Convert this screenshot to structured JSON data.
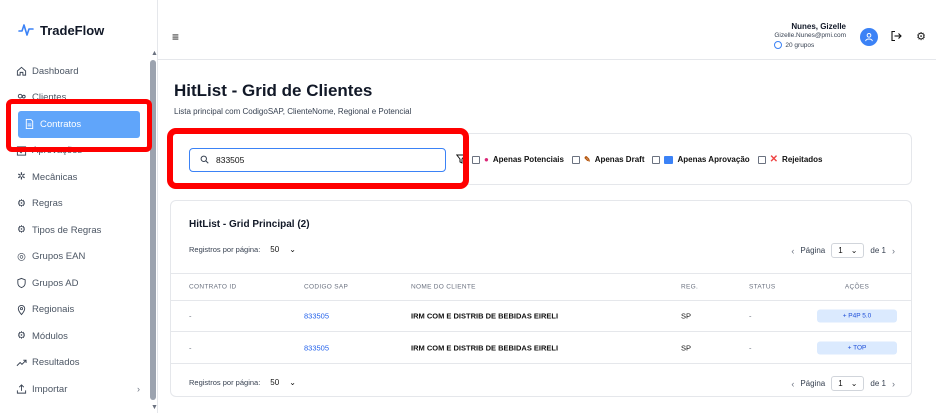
{
  "app": {
    "name": "TradeFlow"
  },
  "sidebar": {
    "items": [
      {
        "label": "Dashboard",
        "icon": "home-icon"
      },
      {
        "label": "Clientes",
        "icon": "users-icon"
      },
      {
        "label": "Contratos",
        "icon": "document-icon",
        "active": true
      },
      {
        "label": "Aprovações",
        "icon": "check-square-icon"
      },
      {
        "label": "Mecânicas",
        "icon": "cog-icon"
      },
      {
        "label": "Regras",
        "icon": "gear-icon"
      },
      {
        "label": "Tipos de Regras",
        "icon": "gear-icon"
      },
      {
        "label": "Grupos EAN",
        "icon": "target-icon"
      },
      {
        "label": "Grupos AD",
        "icon": "shield-icon"
      },
      {
        "label": "Regionais",
        "icon": "map-pin-icon"
      },
      {
        "label": "Módulos",
        "icon": "gear-icon"
      },
      {
        "label": "Resultados",
        "icon": "trend-icon"
      },
      {
        "label": "Importar",
        "icon": "upload-icon",
        "chevron": "›"
      }
    ]
  },
  "header": {
    "menu_icon": "≡",
    "user_name": "Nunes, Gizelle",
    "user_email": "Gizelle.Nunes@pmi.com",
    "groups": "20 grupos",
    "avatar_glyph": "👤",
    "logout_glyph": "↦",
    "settings_glyph": "⚙"
  },
  "page": {
    "title": "HitList - Grid de Clientes",
    "subtitle": "Lista principal com CodigoSAP, ClienteNome, Regional e Potencial"
  },
  "filters": {
    "search_value": "833505",
    "search_icon": "⌕",
    "filter_icon": "∇",
    "checks": [
      {
        "label": "Apenas Potenciais",
        "emoji": "●"
      },
      {
        "label": "Apenas Draft",
        "emoji": "✎"
      },
      {
        "label": "Apenas Aprovação",
        "emoji": "▪"
      },
      {
        "label": "Rejeitados",
        "emoji": "✕"
      }
    ]
  },
  "grid": {
    "title": "HitList - Grid Principal (2)",
    "per_page_label": "Registros por página:",
    "per_page_value": "50",
    "page_label": "Página",
    "page_value": "1",
    "page_of": "de 1",
    "columns": [
      "CONTRATO ID",
      "CODIGO SAP",
      "NOME DO CLIENTE",
      "REG.",
      "STATUS",
      "AÇÕES"
    ],
    "rows": [
      {
        "contrato_id": "-",
        "codigo_sap": "833505",
        "nome": "IRM COM E DISTRIB DE BEBIDAS EIRELI",
        "reg": "SP",
        "status": "-",
        "acao": "+ P4P 5.0"
      },
      {
        "contrato_id": "-",
        "codigo_sap": "833505",
        "nome": "IRM COM E DISTRIB DE BEBIDAS EIRELI",
        "reg": "SP",
        "status": "-",
        "acao": "+ TOP"
      }
    ]
  },
  "colors": {
    "accent": "#3b82f6",
    "active_nav": "#60a5fa",
    "highlight_frame": "#ff0000"
  }
}
